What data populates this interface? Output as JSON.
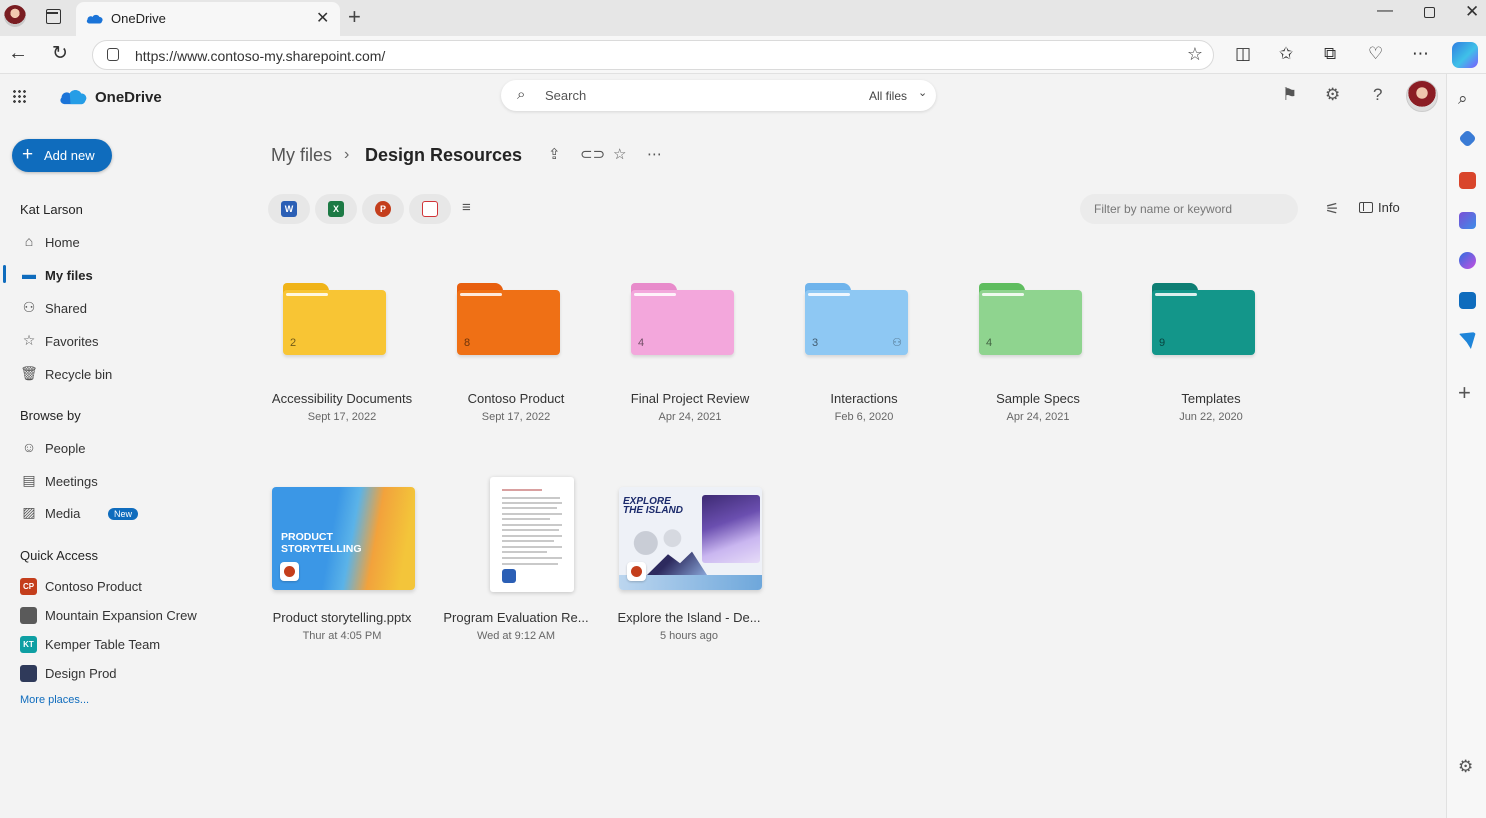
{
  "browser": {
    "tab_title": "OneDrive",
    "url": "https://www.contoso-my.sharepoint.com/"
  },
  "app": {
    "brand": "OneDrive",
    "search_placeholder": "Search",
    "search_scope": "All files"
  },
  "sidebar": {
    "add_new": "Add new",
    "user_name": "Kat Larson",
    "main_items": [
      {
        "label": "Home",
        "icon": "home-icon"
      },
      {
        "label": "My files",
        "icon": "folder-icon"
      },
      {
        "label": "Shared",
        "icon": "people-icon"
      },
      {
        "label": "Favorites",
        "icon": "star-icon"
      },
      {
        "label": "Recycle bin",
        "icon": "trash-icon"
      }
    ],
    "browse_by_title": "Browse by",
    "browse_items": [
      {
        "label": "People",
        "icon": "person-icon"
      },
      {
        "label": "Meetings",
        "icon": "calendar-icon"
      },
      {
        "label": "Media",
        "icon": "image-icon",
        "badge": "New"
      }
    ],
    "quick_access_title": "Quick Access",
    "quick_access": [
      {
        "label": "Contoso Product",
        "initials": "CP",
        "color": "#c43e1c"
      },
      {
        "label": "Mountain Expansion Crew",
        "initials": "",
        "color": "#5a5a5a"
      },
      {
        "label": "Kemper Table Team",
        "initials": "KT",
        "color": "#0e9fa3"
      },
      {
        "label": "Design Prod",
        "initials": "",
        "color": "#2f3a5a"
      }
    ],
    "more_places": "More places..."
  },
  "breadcrumb": {
    "root": "My files",
    "current": "Design Resources"
  },
  "filters": {
    "keyword_placeholder": "Filter by name or keyword",
    "info_label": "Info",
    "type_pills": [
      {
        "name": "word",
        "letter": "W",
        "color": "#2b5fb5"
      },
      {
        "name": "excel",
        "letter": "X",
        "color": "#1d7a45"
      },
      {
        "name": "powerpoint",
        "letter": "P",
        "color": "#c43e1c"
      },
      {
        "name": "pdf",
        "letter": "",
        "color": "#d13438"
      }
    ]
  },
  "folders": [
    {
      "name": "Accessibility Documents",
      "date": "Sept 17, 2022",
      "count": "2",
      "color": "#f8c534",
      "tab_color": "#f0b418"
    },
    {
      "name": "Contoso Product",
      "date": "Sept 17, 2022",
      "count": "8",
      "color": "#ef7015",
      "tab_color": "#e85f0e"
    },
    {
      "name": "Final Project Review",
      "date": "Apr 24, 2021",
      "count": "4",
      "color": "#f3a7dc",
      "tab_color": "#e88bcb"
    },
    {
      "name": "Interactions",
      "date": "Feb 6, 2020",
      "count": "3",
      "color": "#8ec8f3",
      "tab_color": "#6fb4ec",
      "shared": true
    },
    {
      "name": "Sample Specs",
      "date": "Apr 24, 2021",
      "count": "4",
      "color": "#8fd48f",
      "tab_color": "#5fbd5f"
    },
    {
      "name": "Templates",
      "date": "Jun 22, 2020",
      "count": "9",
      "color": "#13968a",
      "tab_color": "#0e7f74"
    }
  ],
  "files": [
    {
      "name": "Product storytelling.pptx",
      "date": "Thur at 4:05 PM",
      "thumb_text_1": "PRODUCT",
      "thumb_text_2": "STORYTELLING"
    },
    {
      "name": "Program Evaluation Re...",
      "date": "Wed at 9:12 AM"
    },
    {
      "name": "Explore the Island - De...",
      "date": "5 hours ago",
      "thumb_text_1": "EXPLORE",
      "thumb_text_2": "THE ISLAND"
    }
  ]
}
